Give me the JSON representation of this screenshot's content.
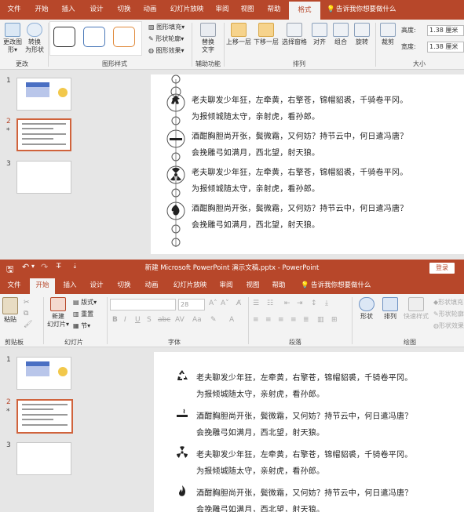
{
  "top": {
    "tabs": [
      "文件",
      "开始",
      "插入",
      "设计",
      "切换",
      "动画",
      "幻灯片放映",
      "审阅",
      "视图",
      "帮助",
      "格式"
    ],
    "tell_me": "告诉我你想要做什么",
    "ribbon": {
      "change_shape_1": "更改图",
      "change_shape_2": "形▾",
      "convert_1": "转换",
      "convert_2": "为形状",
      "group_change": "更改",
      "fill": "图形填充▾",
      "outline": "形状轮廓▾",
      "effects": "图形效果▾",
      "group_styles": "图形样式",
      "alt_text_1": "替换",
      "alt_text_2": "文字",
      "group_access": "辅助功能",
      "bring_forward": "上移一层",
      "send_backward": "下移一层",
      "selection_pane": "选择窗格",
      "align": "对齐",
      "group": "组合",
      "rotate": "旋转",
      "group_arrange": "排列",
      "crop": "裁剪",
      "height_label": "高度:",
      "height_value": "1.38 厘米",
      "width_label": "宽度:",
      "width_value": "1.38 厘米",
      "group_size": "大小"
    },
    "slide_numbers": [
      "1",
      "2",
      "3"
    ]
  },
  "bottom": {
    "quick_access_touch": "T̶",
    "window_title": "新建 Microsoft PowerPoint 演示文稿.pptx  -  PowerPoint",
    "login": "登录",
    "tabs": [
      "文件",
      "开始",
      "插入",
      "设计",
      "切换",
      "动画",
      "幻灯片放映",
      "审阅",
      "视图",
      "帮助"
    ],
    "tell_me": "告诉我你想要做什么",
    "ribbon": {
      "paste": "粘贴",
      "group_clipboard": "剪贴板",
      "new_slide_1": "新建",
      "new_slide_2": "幻灯片▾",
      "layout": "版式▾",
      "reset": "重置",
      "section": "节▾",
      "group_slides": "幻灯片",
      "font_size": "28",
      "group_font": "字体",
      "group_paragraph": "段落",
      "shape": "形状",
      "arrange": "排列",
      "quick_styles": "快速样式",
      "shape_fill": "形状填充",
      "shape_outline": "形状轮廓",
      "shape_effects": "形状效果",
      "group_drawing": "绘图"
    },
    "slide_numbers": [
      "1",
      "2",
      "3"
    ]
  },
  "poem": {
    "lines": [
      "老夫聊发少年狂，左牵黄，右擎苍，锦帽貂裘，千骑卷平冈。",
      "为报倾城随太守，亲射虎，看孙郎。",
      "酒酣胸胆尚开张，鬓微霜，又何妨？持节云中，何日遣冯唐？",
      "会挽雕弓如满月，西北望，射天狼。",
      "老夫聊发少年狂，左牵黄，右擎苍，锦帽貂裘，千骑卷平冈。",
      "为报倾城随太守，亲射虎，看孙郎。",
      "酒酣胸胆尚开张，鬓微霜，又何妨？持节云中，何日遣冯唐？",
      "会挽雕弓如满月，西北望，射天狼。"
    ],
    "bottom_bullet_icons": [
      "recycle-icon",
      "smoking-icon",
      "radiation-icon",
      "flame-icon"
    ]
  },
  "colors": {
    "accent": "#b7472a",
    "ribbon_bg": "#f3f3f3",
    "selected_border": "#d0633c"
  }
}
